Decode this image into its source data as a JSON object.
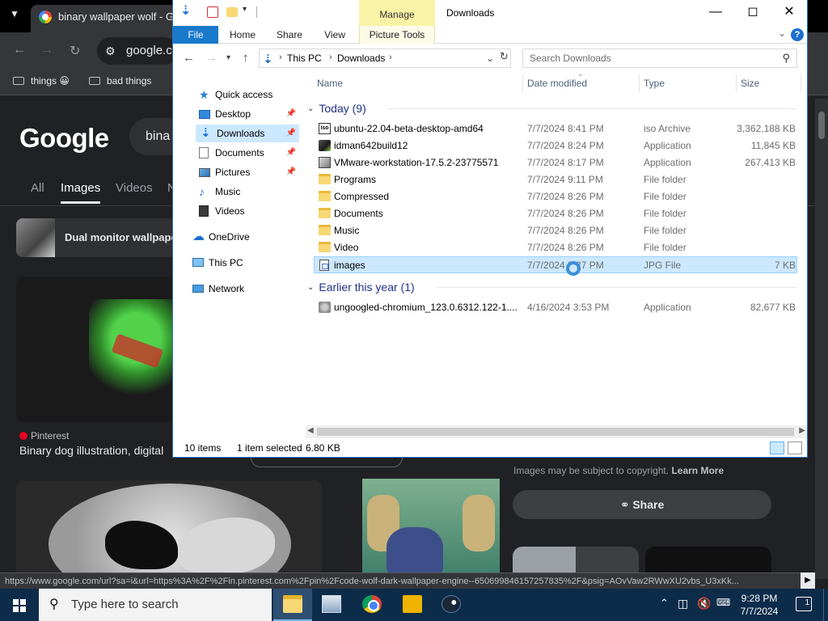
{
  "chrome": {
    "tab_title": "binary wallpaper wolf - Go",
    "omnibox": "google.co",
    "bookmarks": [
      "things 😀",
      "bad things"
    ],
    "search_query": "bina",
    "logo": "Google",
    "tabs": [
      "All",
      "Images",
      "Videos",
      "N"
    ],
    "active_tab": "Images",
    "result_title": "Dual monitor wallpape",
    "pin_source": "Pinterest",
    "pin_title": "Binary dog illustration, digital",
    "copyright_text": "Images may be subject to copyright.",
    "learn_more": "Learn More",
    "share_label": "Share",
    "status_url": "https://www.google.com/url?sa=i&url=https%3A%2F%2Fin.pinterest.com%2Fpin%2Fcode-wolf-dark-wallpaper-engine--650699846157257835%2F&psig=AOvVaw2RWwXU2vbs_U3xKk..."
  },
  "explorer": {
    "window_title": "Downloads",
    "manage_label": "Manage",
    "ribbon_tabs": [
      "File",
      "Home",
      "Share",
      "View",
      "Picture Tools"
    ],
    "help_label": "?",
    "breadcrumb": [
      "This PC",
      "Downloads"
    ],
    "search_placeholder": "Search Downloads",
    "nav": [
      {
        "label": "Quick access",
        "icon": "star-icon",
        "pinned": false
      },
      {
        "label": "Desktop",
        "icon": "desktop-icon",
        "pinned": true
      },
      {
        "label": "Downloads",
        "icon": "download-icon",
        "pinned": true,
        "selected": true
      },
      {
        "label": "Documents",
        "icon": "documents-icon",
        "pinned": true
      },
      {
        "label": "Pictures",
        "icon": "pictures-icon",
        "pinned": true
      },
      {
        "label": "Music",
        "icon": "music-icon",
        "pinned": false
      },
      {
        "label": "Videos",
        "icon": "videos-icon",
        "pinned": false
      },
      {
        "label": "OneDrive",
        "icon": "cloud-icon",
        "pinned": false
      },
      {
        "label": "This PC",
        "icon": "computer-icon",
        "pinned": false
      },
      {
        "label": "Network",
        "icon": "network-icon",
        "pinned": false
      }
    ],
    "columns": [
      "Name",
      "Date modified",
      "Type",
      "Size"
    ],
    "groups": [
      {
        "label": "Today (9)",
        "files": [
          {
            "name": "ubuntu-22.04-beta-desktop-amd64",
            "date": "7/7/2024 8:41 PM",
            "type": "iso Archive",
            "size": "3,362,188 KB",
            "icon": "iso-file-icon",
            "icon_text": "iso"
          },
          {
            "name": "idman642build12",
            "date": "7/7/2024 8:24 PM",
            "type": "Application",
            "size": "11,845 KB",
            "icon": "app-icon"
          },
          {
            "name": "VMware-workstation-17.5.2-23775571",
            "date": "7/7/2024 8:17 PM",
            "type": "Application",
            "size": "267,413 KB",
            "icon": "vmware-icon"
          },
          {
            "name": "Programs",
            "date": "7/7/2024 9:11 PM",
            "type": "File folder",
            "size": "",
            "icon": "folder-icon"
          },
          {
            "name": "Compressed",
            "date": "7/7/2024 8:26 PM",
            "type": "File folder",
            "size": "",
            "icon": "folder-icon"
          },
          {
            "name": "Documents",
            "date": "7/7/2024 8:26 PM",
            "type": "File folder",
            "size": "",
            "icon": "folder-icon"
          },
          {
            "name": "Music",
            "date": "7/7/2024 8:26 PM",
            "type": "File folder",
            "size": "",
            "icon": "folder-icon"
          },
          {
            "name": "Video",
            "date": "7/7/2024 8:26 PM",
            "type": "File folder",
            "size": "",
            "icon": "folder-icon"
          },
          {
            "name": "images",
            "date": "7/7/2024 9:27 PM",
            "type": "JPG File",
            "size": "7 KB",
            "icon": "image-file-icon",
            "selected": true
          }
        ]
      },
      {
        "label": "Earlier this year (1)",
        "files": [
          {
            "name": "ungoogled-chromium_123.0.6312.122-1....",
            "date": "4/16/2024 3:53 PM",
            "type": "Application",
            "size": "82,677 KB",
            "icon": "chromium-installer-icon"
          }
        ]
      }
    ],
    "status_items": "10 items",
    "status_selected": "1 item selected",
    "status_size": "6.80 KB"
  },
  "taskbar": {
    "search_placeholder": "Type here to search",
    "time": "9:28 PM",
    "date": "7/7/2024",
    "notifications": "1"
  },
  "colors": {
    "accent": "#1979ca",
    "selection": "#cce8ff",
    "taskbar": "#0c2c4a",
    "chrome_bg": "#202124"
  }
}
